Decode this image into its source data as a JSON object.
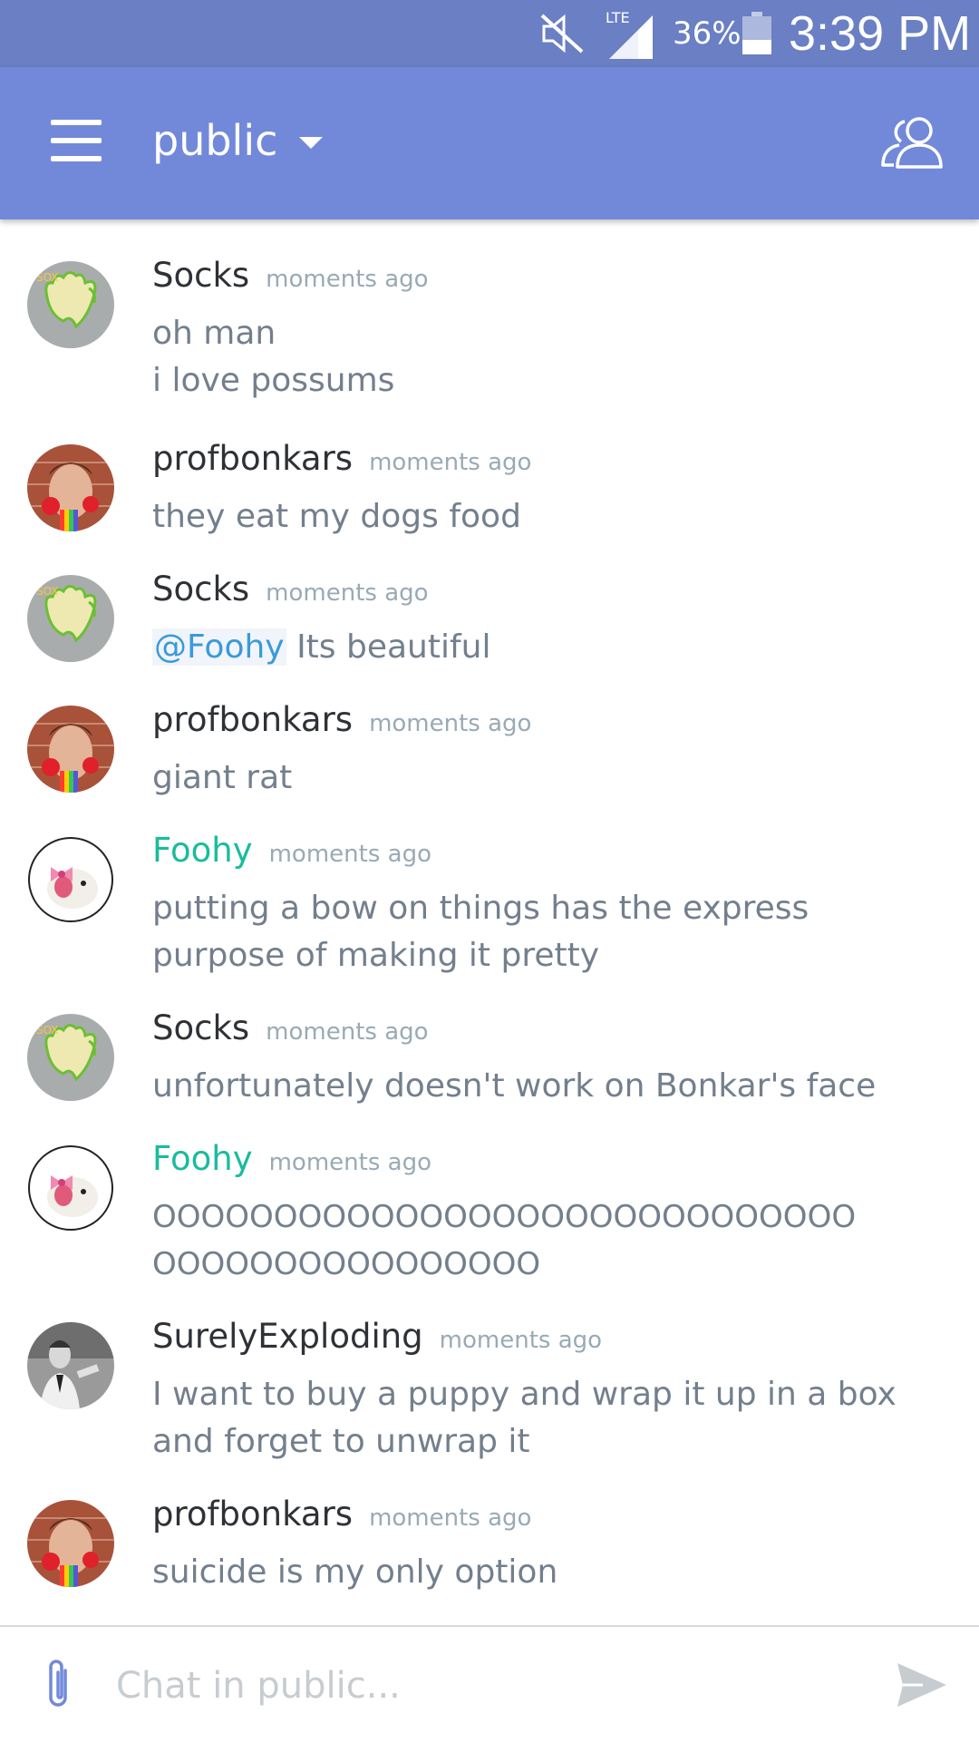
{
  "status_bar": {
    "network": "LTE",
    "battery": "36%",
    "time": "3:39 PM"
  },
  "header": {
    "channel": "public"
  },
  "messages": [
    {
      "user": "Socks",
      "time": "moments ago",
      "lines": [
        "oh man",
        "i love possums"
      ]
    },
    {
      "user": "profbonkars",
      "time": "moments ago",
      "lines": [
        "they eat my dogs food"
      ]
    },
    {
      "user": "Socks",
      "time": "moments ago",
      "mention": "@Foohy",
      "lines": [
        "Its beautiful"
      ]
    },
    {
      "user": "profbonkars",
      "time": "moments ago",
      "lines": [
        "giant rat"
      ]
    },
    {
      "user": "Foohy",
      "time": "moments ago",
      "lines": [
        "putting a bow on things has the express purpose of making it pretty"
      ]
    },
    {
      "user": "Socks",
      "time": "moments ago",
      "lines": [
        "unfortunately doesn't work on Bonkar's face"
      ]
    },
    {
      "user": "Foohy",
      "time": "moments ago",
      "lines": [
        "OOOOOOOOOOOOOOOOOOOOOOOOOOOOO",
        "OOOOOOOOOOOOOOOO"
      ]
    },
    {
      "user": "SurelyExploding",
      "time": "moments ago",
      "lines": [
        "I want to buy a puppy and wrap it up in a box and forget to unwrap it"
      ]
    },
    {
      "user": "profbonkars",
      "time": "moments ago",
      "lines": [
        "suicide is my only option"
      ]
    }
  ],
  "input": {
    "placeholder": "Chat in public..."
  },
  "colors": {
    "status_bar": "#6a7fc4",
    "app_bar": "#7289da",
    "username_highlight": "#1abc9c",
    "mention": "#3a9ad9"
  }
}
